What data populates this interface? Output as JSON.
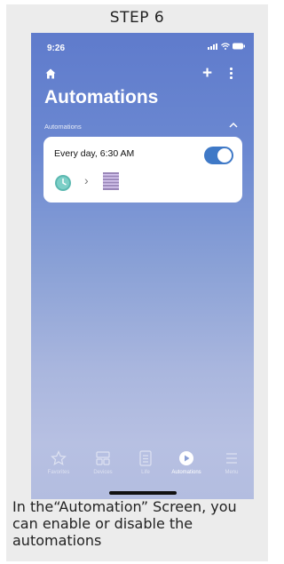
{
  "step": "STEP 6",
  "phone": {
    "status_time": "9:26",
    "title": "Automations",
    "section_label": "Automations",
    "automation": {
      "title": "Every day, 6:30 AM",
      "enabled": true
    },
    "tabs": [
      {
        "label": "Favorites",
        "icon": "star-icon",
        "active": false
      },
      {
        "label": "Devices",
        "icon": "devices-icon",
        "active": false
      },
      {
        "label": "Life",
        "icon": "life-icon",
        "active": false
      },
      {
        "label": "Automations",
        "icon": "play-icon",
        "active": true
      },
      {
        "label": "Menu",
        "icon": "menu-icon",
        "active": false
      }
    ]
  },
  "caption": "In the“Automation” Screen, you can enable or disable the automations",
  "colors": {
    "toggle_on": "#3f79c7",
    "background_top": "#5f7bcc",
    "background_bottom": "#b3bde0"
  }
}
